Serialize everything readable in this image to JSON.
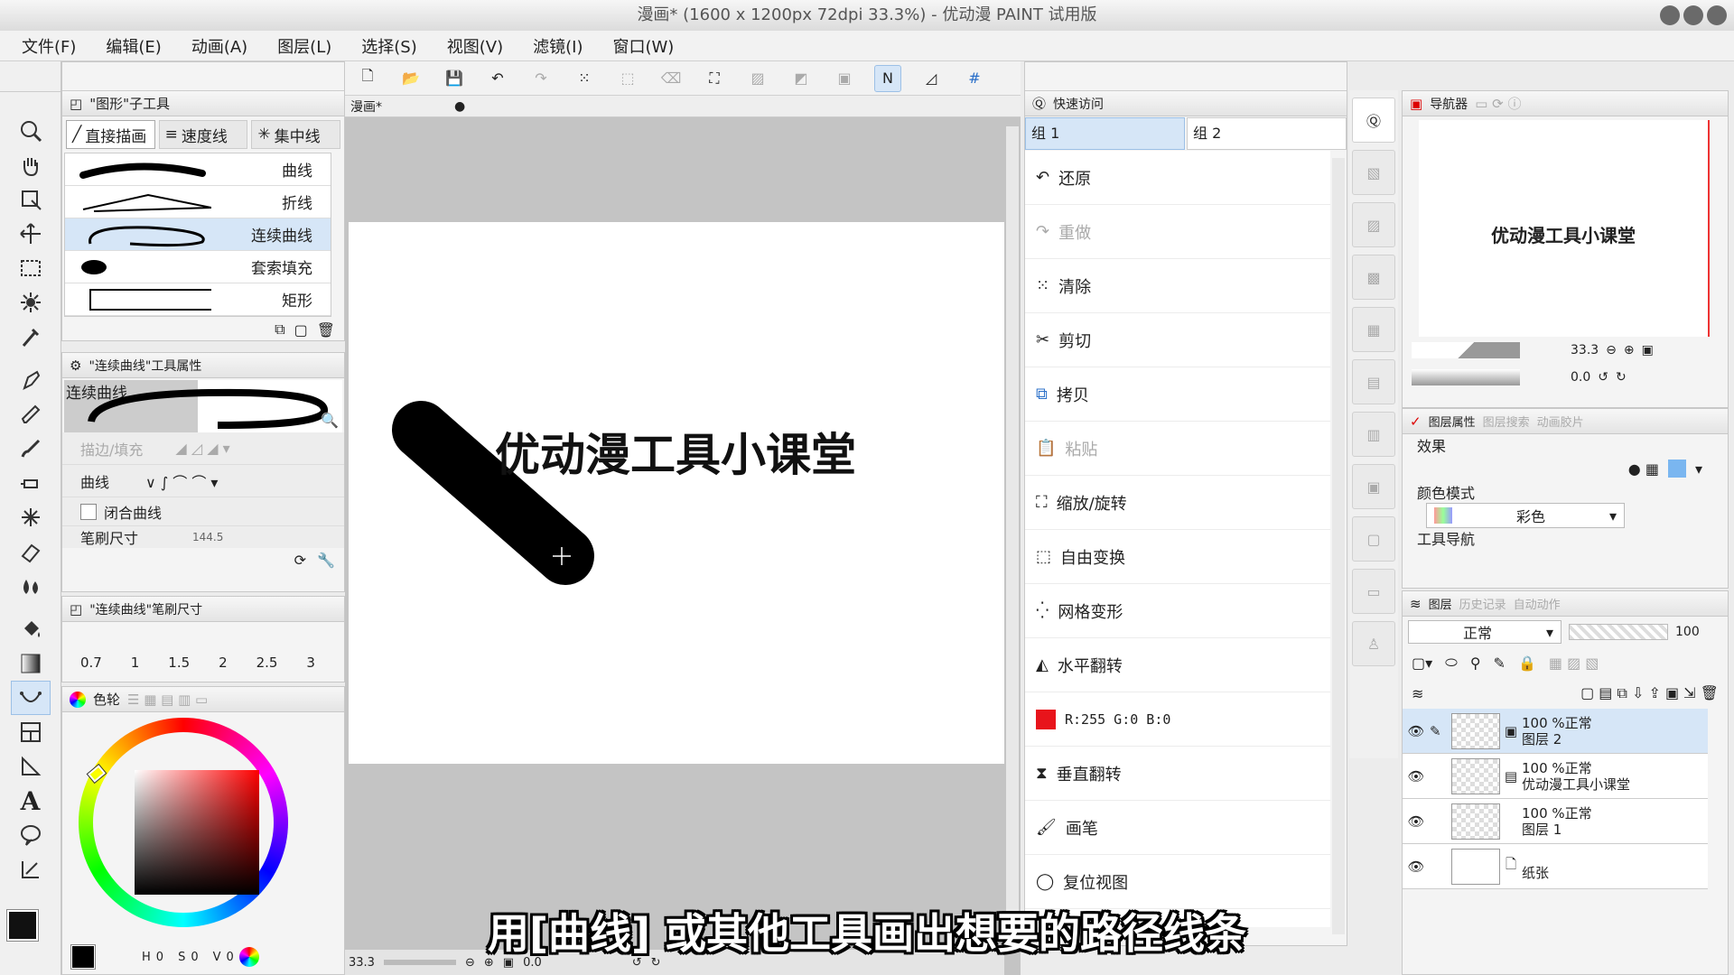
{
  "window": {
    "title": "漫画* (1600 x 1200px 72dpi 33.3%)  - 优动漫 PAINT 试用版"
  },
  "menu": [
    "文件(F)",
    "编辑(E)",
    "动画(A)",
    "图层(L)",
    "选择(S)",
    "视图(V)",
    "滤镜(I)",
    "窗口(W)"
  ],
  "subtool_panel": {
    "title": "\"图形\"子工具",
    "tabs": [
      "直接描画",
      "速度线",
      "集中线"
    ],
    "items": [
      "曲线",
      "折线",
      "连续曲线",
      "套索填充",
      "矩形"
    ],
    "selected_index": 2
  },
  "tool_property": {
    "title": "\"连续曲线\"工具属性",
    "preview_label": "连续曲线",
    "stroke_fill_label": "描边/填充",
    "curve_label": "曲线",
    "closed_curve_label": "闭合曲线",
    "brush_size_label": "笔刷尺寸",
    "brush_size_value": "144.5"
  },
  "brush_size_panel": {
    "title": "\"连续曲线\"笔刷尺寸",
    "sizes": [
      "0.7",
      "1",
      "1.5",
      "2",
      "2.5",
      "3"
    ]
  },
  "color_panel": {
    "tab": "色轮",
    "footer": {
      "h_label": "H",
      "h_value": "0",
      "s_label": "S",
      "s_value": "0",
      "v_label": "V",
      "v_value": "0"
    }
  },
  "canvas": {
    "tab_label": "漫画*",
    "text": "优动漫工具小课堂",
    "zoom": "33.3",
    "rotation": "0.0"
  },
  "quick_access": {
    "title": "快速访问",
    "groups": [
      "组 1",
      "组 2"
    ],
    "items": [
      {
        "label": "还原",
        "icon": "undo-icon",
        "enabled": true
      },
      {
        "label": "重做",
        "icon": "redo-icon",
        "enabled": false
      },
      {
        "label": "清除",
        "icon": "clear-icon",
        "enabled": true
      },
      {
        "label": "剪切",
        "icon": "scissors-icon",
        "enabled": true
      },
      {
        "label": "拷贝",
        "icon": "copy-icon",
        "enabled": true
      },
      {
        "label": "粘贴",
        "icon": "paste-icon",
        "enabled": false
      },
      {
        "label": "缩放/旋转",
        "icon": "scale-rotate-icon",
        "enabled": true
      },
      {
        "label": "自由变换",
        "icon": "free-transform-icon",
        "enabled": true
      },
      {
        "label": "网格变形",
        "icon": "mesh-transform-icon",
        "enabled": true
      },
      {
        "label": "水平翻转",
        "icon": "flip-horizontal-icon",
        "enabled": true
      },
      {
        "label": "R:255 G:0 B:0",
        "icon": "color-swatch-icon",
        "enabled": true
      },
      {
        "label": "垂直翻转",
        "icon": "flip-vertical-icon",
        "enabled": true
      },
      {
        "label": "画笔",
        "icon": "brush-icon",
        "enabled": true
      },
      {
        "label": "复位视图",
        "icon": "reset-view-icon",
        "enabled": true
      }
    ],
    "swatch_color": "#e8141b"
  },
  "navigator": {
    "title": "导航器",
    "preview_text": "优动漫工具小课堂",
    "zoom": "33.3",
    "rotation": "0.0"
  },
  "layer_property": {
    "tabs": [
      "图层属性",
      "图层搜索",
      "动画胶片"
    ],
    "effect_label": "效果",
    "color_mode_label": "颜色模式",
    "color_mode_value": "彩色",
    "tool_nav_label": "工具导航"
  },
  "layers_panel": {
    "tabs": [
      "图层",
      "历史记录",
      "自动动作"
    ],
    "blend_mode": "正常",
    "opacity": "100",
    "layers": [
      {
        "meta": "100 %正常",
        "name": "图层 2",
        "selected": true
      },
      {
        "meta": "100 %正常",
        "name": "优动漫工具小课堂",
        "selected": false
      },
      {
        "meta": "100 %正常",
        "name": "图层 1",
        "selected": false
      },
      {
        "meta": "",
        "name": "纸张",
        "selected": false
      }
    ]
  },
  "subtitle": "用[曲线] 或其他工具画出想要的路径线条"
}
